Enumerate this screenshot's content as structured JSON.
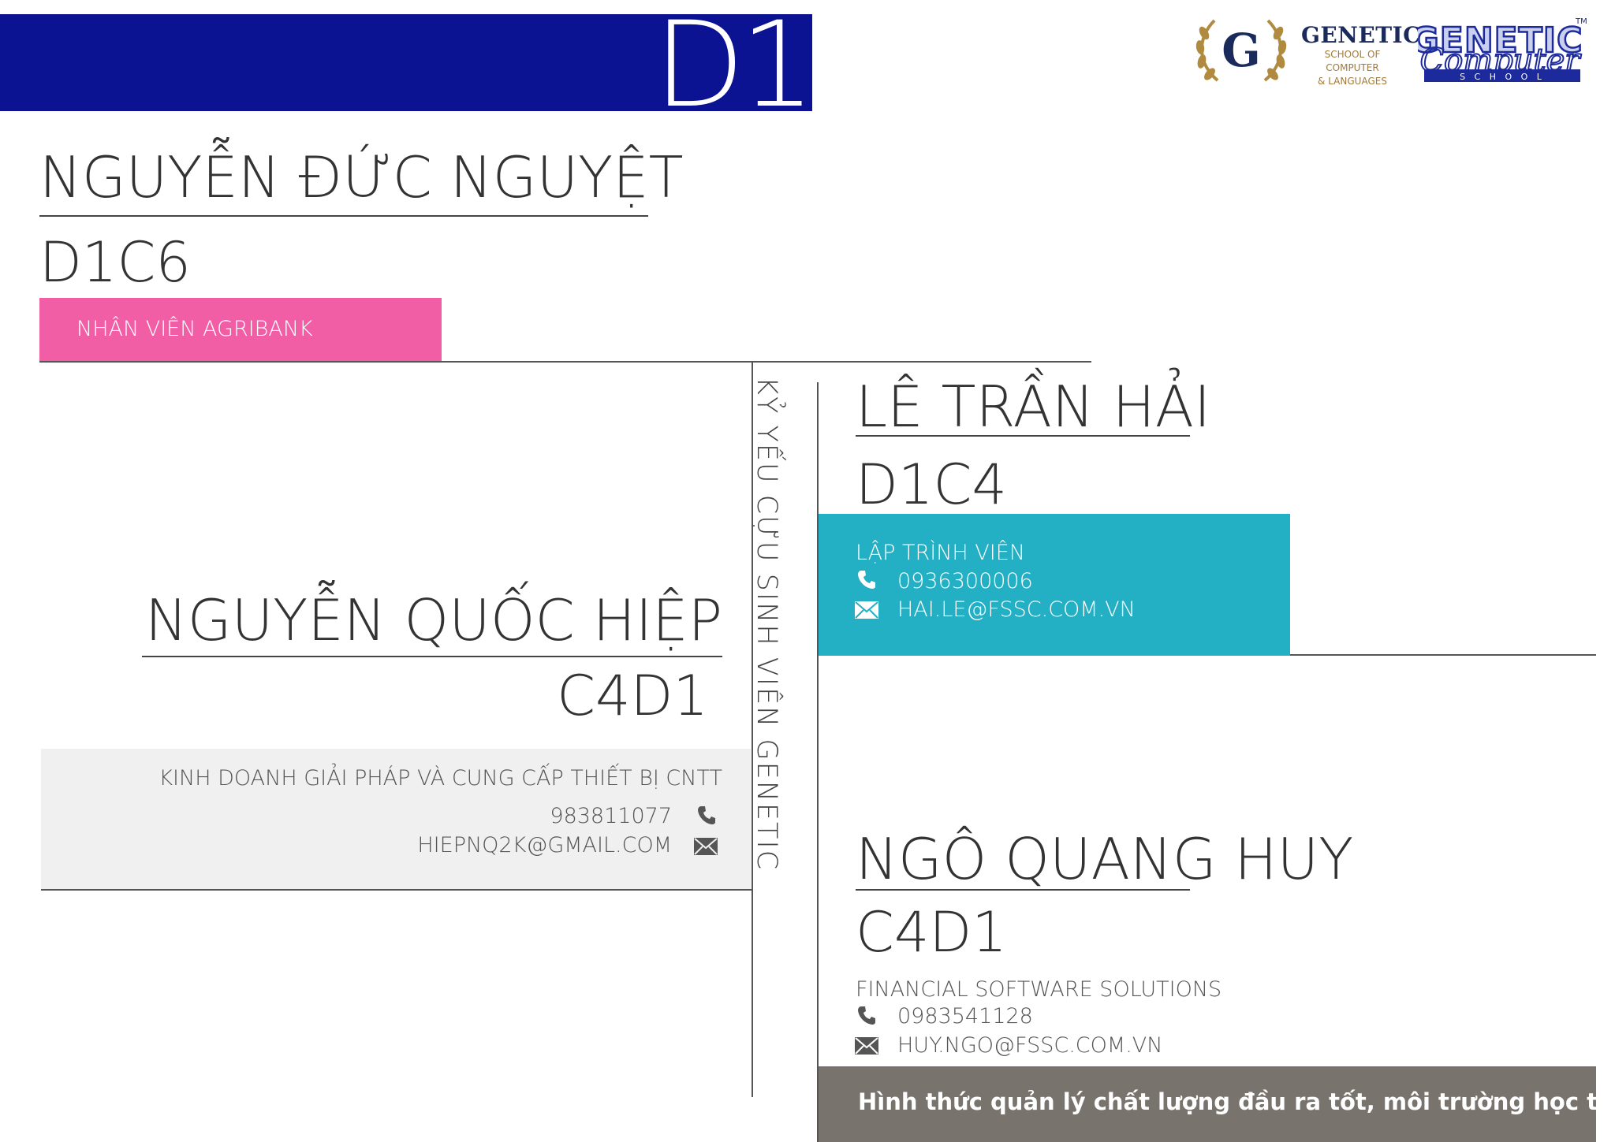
{
  "banner": {
    "label": "D1"
  },
  "logos": {
    "g_letter": "G",
    "genetic_title": "GENETIC",
    "genetic_sub1": "SCHOOL OF",
    "genetic_sub2": "COMPUTER",
    "genetic_sub3": "& LANGUAGES",
    "gc_title": "GENETIC",
    "gc_script": "Computer",
    "gc_school": "S C H O O L",
    "gc_tm": "TM"
  },
  "vertical_caption": "KỶ YẾU CỰU SINH VIÊN GENETIC",
  "profiles": {
    "p1": {
      "name": "NGUYỄN ĐỨC NGUYỆT",
      "class": "D1C6",
      "job": "NHÂN VIÊN AGRIBANK"
    },
    "p2": {
      "name": "NGUYỄN QUỐC HIỆP",
      "class": "C4D1",
      "job": "KINH DOANH GIẢI PHÁP VÀ CUNG CẤP THIẾT BỊ CNTT",
      "phone": "983811077",
      "email": "HIEPNQ2K@GMAIL.COM"
    },
    "p3": {
      "name": "LÊ TRẦN HẢI",
      "class": "D1C4",
      "job": "LẬP TRÌNH VIÊN",
      "phone": "0936300006",
      "email": "HAI.LE@FSSC.COM.VN"
    },
    "p4": {
      "name": "NGÔ QUANG HUY",
      "class": "C4D1",
      "job": "FINANCIAL SOFTWARE SOLUTIONS",
      "phone": "0983541128",
      "email": "HUY.NGO@FSSC.COM.VN"
    }
  },
  "footer_quote": "Hình thức quản lý chất lượng đầu ra tốt, môi trường học tập tốt.",
  "colors": {
    "banner": "#0b1393",
    "pink": "#f25ea6",
    "teal": "#23afc4",
    "grey": "#f0f0f0",
    "footer": "#78736d"
  },
  "icons": {
    "phone": "phone-icon",
    "email": "envelope-icon"
  }
}
